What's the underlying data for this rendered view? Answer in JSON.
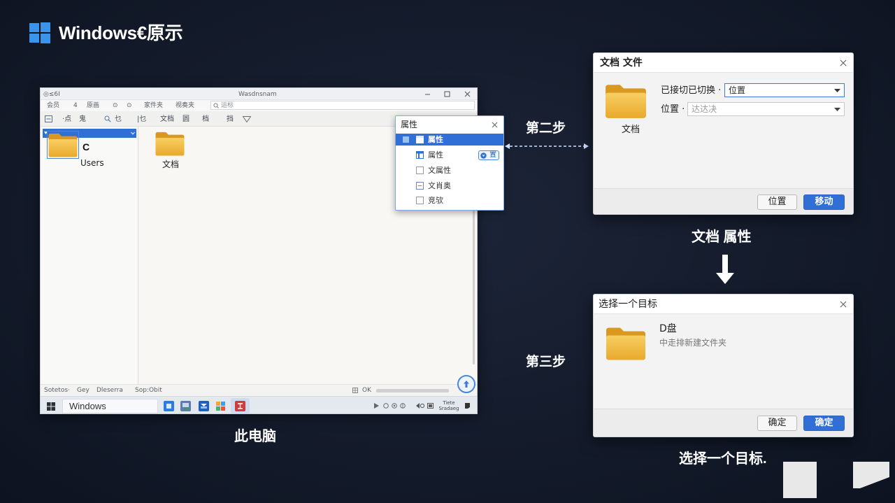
{
  "header": {
    "title": "Windows€原示",
    "logo_icon": "windows-logo-icon"
  },
  "theme": {
    "background": "#131a2a",
    "accent": "#2f6fd6",
    "folder": "#f0b83f",
    "caption_text": "#ffffff"
  },
  "explorer": {
    "title_left": "◎≤6Ⅰ",
    "title": "Wasdnsnam",
    "window_controls": [
      "minimize-icon",
      "maximize-icon",
      "close-icon"
    ],
    "menu": [
      "会员",
      "4",
      "原画",
      "⊙",
      "⊙",
      "家件夹",
      "视奏夹"
    ],
    "search_placeholder": "运标",
    "toolbar": [
      "·点",
      "鬼",
      "乜",
      "|乜",
      "文档",
      "圆",
      "档",
      "挡"
    ],
    "toolbar_icons": [
      "layout-icon",
      "search-icon",
      "filter-icon"
    ],
    "nav": {
      "drive": "C",
      "folder": "Users"
    },
    "main_folder": "文档",
    "status": [
      "Sotetos·",
      "Gey",
      "Dleserra",
      "Sop:Obit"
    ],
    "status_right": "OK",
    "taskbar": {
      "search_text": "Windows",
      "clock_line1": "Tiete",
      "clock_line2": "Sradaeg",
      "apps": [
        "file-explorer-icon",
        "photos-icon",
        "mail-icon",
        "store-icon",
        "app-icon"
      ]
    }
  },
  "context_menu": {
    "title": "属性",
    "items": [
      {
        "label": "属性",
        "icon": "window-icon",
        "selected": true
      },
      {
        "label": "属性",
        "icon": "document-icon",
        "chip": "置"
      },
      {
        "label": "文属性",
        "icon": "checkbox-icon"
      },
      {
        "label": "文肖奥",
        "icon": "list-icon"
      },
      {
        "label": "竞欤",
        "icon": "checkbox-icon"
      }
    ]
  },
  "steps": {
    "step2": "第二步",
    "step3": "第三步"
  },
  "dialog_properties": {
    "title": "文档 文件",
    "folder_label": "文档",
    "field1_label": "已接切已切换 ·",
    "field1_value": "位置",
    "field2_label": "位置 ·",
    "field2_placeholder": "达达决",
    "btn_secondary": "位置",
    "btn_primary": "移动"
  },
  "dialog_target": {
    "title": "选择一个目标",
    "item_title": "D盘",
    "item_subtitle": "中走排新建文件夹",
    "btn_secondary": "确定",
    "btn_primary": "确定"
  },
  "captions": {
    "explorer": "此电脑",
    "properties": "文档 属性",
    "target": "选择一个目标."
  }
}
